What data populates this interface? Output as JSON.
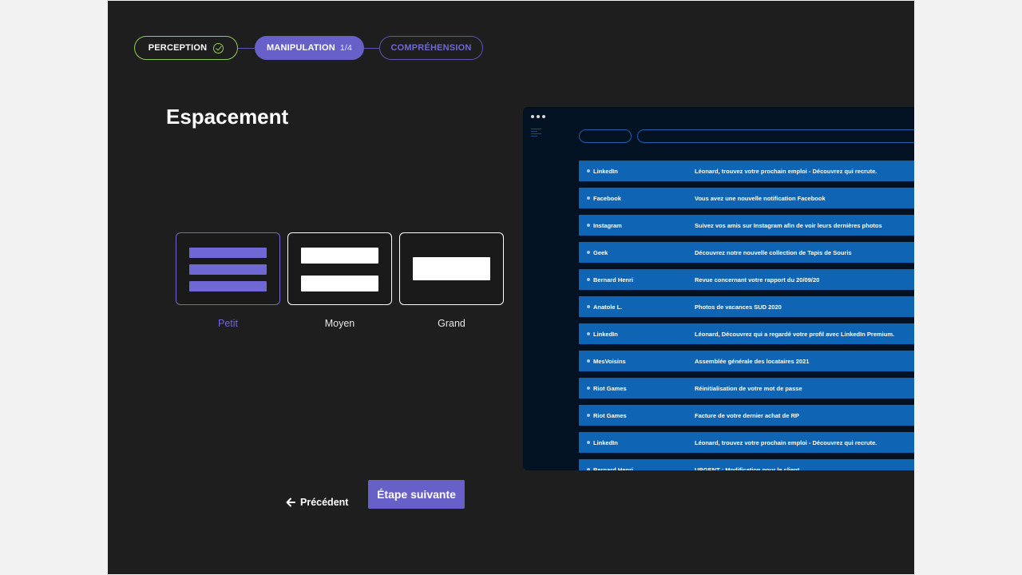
{
  "stepper": {
    "steps": [
      {
        "label": "PERCEPTION",
        "status": "done"
      },
      {
        "label": "MANIPULATION",
        "count": "1/4",
        "status": "active"
      },
      {
        "label": "COMPRÉHENSION",
        "status": "upcoming"
      }
    ]
  },
  "page": {
    "title": "Espacement"
  },
  "options": [
    {
      "label": "Petit",
      "selected": true
    },
    {
      "label": "Moyen",
      "selected": false
    },
    {
      "label": "Grand",
      "selected": false
    }
  ],
  "nav": {
    "previous_label": "Précédent",
    "next_label": "Étape suivante"
  },
  "mail_preview": {
    "rows": [
      {
        "sender": "LinkedIn",
        "subject": "Léonard, trouvez votre prochain emploi - Découvrez qui recrute."
      },
      {
        "sender": "Facebook",
        "subject": "Vous avez une nouvelle notification Facebook"
      },
      {
        "sender": "Instagram",
        "subject": "Suivez vos amis sur Instagram afin de voir leurs dernières photos"
      },
      {
        "sender": "Geek",
        "subject": "Découvrez notre nouvelle collection de Tapis de Souris"
      },
      {
        "sender": "Bernard Henri",
        "subject": "Revue concernant votre rapport du 20/09/20"
      },
      {
        "sender": "Anatole L.",
        "subject": "Photos de vacances SUD 2020"
      },
      {
        "sender": "LinkedIn",
        "subject": "Léonard, Découvrez qui a regardé votre profil avec LinkedIn Premium."
      },
      {
        "sender": "MesVoisins",
        "subject": "Assemblée générale des locataires 2021"
      },
      {
        "sender": "Riot Games",
        "subject": "Réinitialisation de votre mot de passe"
      },
      {
        "sender": "Riot Games",
        "subject": "Facture de votre dernier achat de RP"
      },
      {
        "sender": "LinkedIn",
        "subject": "Léonard, trouvez votre prochain emploi - Découvrez qui recrute."
      },
      {
        "sender": "Bernard Henri",
        "subject": "URGENT : Modification pour le client"
      }
    ]
  },
  "colors": {
    "background": "#1e1e1e",
    "accent": "#6760c8",
    "done": "#8ecf55",
    "mail_row": "#0f65b3",
    "preview_bg": "#031222"
  }
}
